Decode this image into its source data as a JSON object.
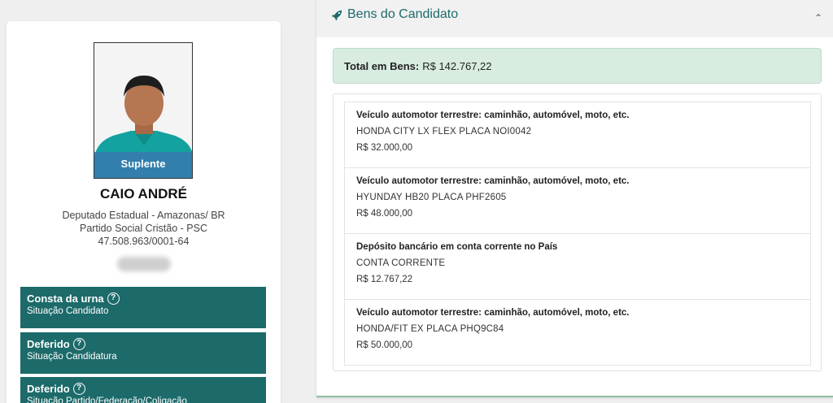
{
  "candidate": {
    "photo_badge": "Suplente",
    "name": "CAIO ANDRÉ",
    "office": "Deputado Estadual - Amazonas/ BR",
    "party": "Partido Social Cristão - PSC",
    "cnpj": "47.508.963/0001-64",
    "status_boxes": [
      {
        "title": "Consta da urna",
        "subtitle": "Situação Candidato"
      },
      {
        "title": "Deferido",
        "subtitle": "Situação Candidatura"
      },
      {
        "title": "Deferido",
        "subtitle": "Situação Partido/Federação/Coligação"
      }
    ]
  },
  "assets_panel": {
    "title": "Bens do Candidato",
    "icon": "rocket-icon",
    "total_label": "Total em Bens:",
    "total_value": "R$ 142.767,22",
    "items": [
      {
        "type": "Veículo automotor terrestre: caminhão, automóvel, moto, etc.",
        "description": "HONDA CITY LX FLEX PLACA NOI0042",
        "value": "R$ 32.000,00"
      },
      {
        "type": "Veículo automotor terrestre: caminhão, automóvel, moto, etc.",
        "description": "HYUNDAY HB20 PLACA PHF2605",
        "value": "R$ 48.000,00"
      },
      {
        "type": "Depósito bancário em conta corrente no País",
        "description": "CONTA CORRENTE",
        "value": "R$ 12.767,22"
      },
      {
        "type": "Veículo automotor terrestre: caminhão, automóvel, moto, etc.",
        "description": "HONDA/FIT EX PLACA PHQ9C84",
        "value": "R$ 50.000,00"
      }
    ]
  },
  "colors": {
    "accent": "#1d6a6a",
    "total_bg": "#d8ece0",
    "badge_bg": "#3978b0"
  }
}
